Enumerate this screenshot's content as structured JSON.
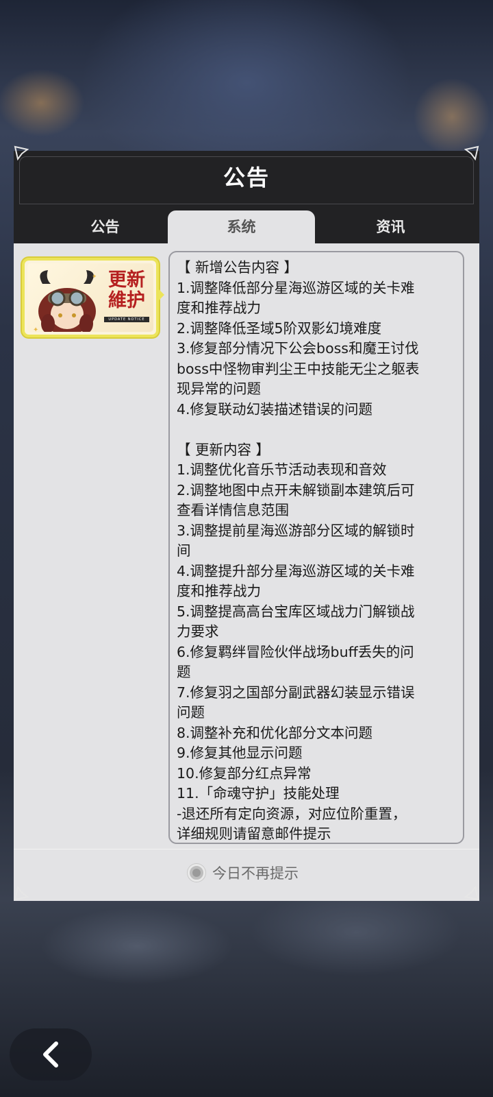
{
  "dialog": {
    "title": "公告",
    "tabs": [
      {
        "label": "公告",
        "active": false
      },
      {
        "label": "系统",
        "active": true
      },
      {
        "label": "资讯",
        "active": false
      }
    ],
    "thumbnail": {
      "title_line1": "更新",
      "title_line2": "維护",
      "subtitle": "UPDATE NOTICE"
    },
    "content_lines": [
      "【 新增公告内容 】",
      "1.调整降低部分星海巡游区域的关卡难",
      "度和推荐战力",
      "2.调整降低圣域5阶双影幻境难度",
      "3.修复部分情况下公会boss和魔王讨伐",
      "boss中怪物审判尘王中技能无尘之躯表",
      "现异常的问题",
      "4.修复联动幻装描述错误的问题",
      "",
      "【 更新内容 】",
      "1.调整优化音乐节活动表现和音效",
      "2.调整地图中点开未解锁副本建筑后可",
      "查看详情信息范围",
      "3.调整提前星海巡游部分区域的解锁时",
      "间",
      "4.调整提升部分星海巡游区域的关卡难",
      "度和推荐战力",
      "5.调整提高高台宝库区域战力门解锁战",
      "力要求",
      "6.修复羁绊冒险伙伴战场buff丢失的问",
      "题",
      "7.修复羽之国部分副武器幻装显示错误",
      "问题",
      "8.调整补充和优化部分文本问题",
      "9.修复其他显示问题",
      "10.修复部分红点异常",
      "11.「命魂守护」技能处理",
      "-退还所有定向资源，对应位阶重置，",
      "详细规则请留意邮件提示"
    ],
    "footer": {
      "dont_show_label": "今日不再提示"
    }
  },
  "colors": {
    "header_bg": "#222224",
    "panel_bg": "#e3e3e5",
    "thumb_border": "#ece45a",
    "thumb_title": "#b52020"
  },
  "icons": {
    "back": "chevron-left-icon",
    "corner": "corner-ornament-icon",
    "radio": "radio-unchecked-icon"
  }
}
